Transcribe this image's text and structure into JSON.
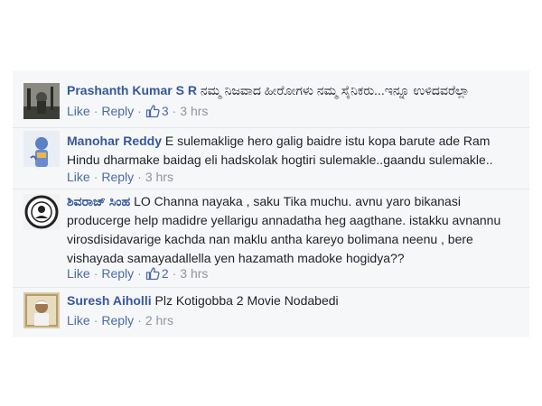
{
  "comments": [
    {
      "author": "Prashanth Kumar S R",
      "text": "ನಮ್ಮ ನಿಜವಾದ ಹೀರೋಗಳು ನಮ್ಮ ಸೈನಿಕರು...ಇನ್ನೂ ಉಳಿದವರೆಲ್ಲಾ",
      "like_label": "Like",
      "reply_label": "Reply",
      "likes": "3",
      "time": "3 hrs",
      "avatar_icon": "profile-photo"
    },
    {
      "author": "Manohar Reddy",
      "text": "E sulemaklige hero galig baidre istu kopa barute ade Ram Hindu dharmake baidag eli hadskolak hogtiri sulemakle..gaandu sulemakle..",
      "like_label": "Like",
      "reply_label": "Reply",
      "likes": "",
      "time": "3 hrs",
      "avatar_icon": "profile-photo"
    },
    {
      "author": "ಶಿವರಾಜ್ ಸಿಂಹ",
      "text": "LO Channa nayaka , saku Tika muchu. avnu yaro bikanasi producerge help madidre yellarigu annadatha heg aagthane. istakku avnannu virosdisidavarige kachda nan maklu antha kareyo bolimana neenu , bere vishayada samayadallella yen hazamath madoke hogidya??",
      "like_label": "Like",
      "reply_label": "Reply",
      "likes": "2",
      "time": "3 hrs",
      "avatar_icon": "profile-photo"
    },
    {
      "author": "Suresh Aiholli",
      "text": "Plz Kotigobba 2 Movie Nodabedi",
      "like_label": "Like",
      "reply_label": "Reply",
      "likes": "",
      "time": "2 hrs",
      "avatar_icon": "profile-photo"
    }
  ],
  "colors": {
    "author": "#365899",
    "link": "#4b6aa8",
    "meta": "#90949c",
    "panel": "#f6f7f9"
  }
}
